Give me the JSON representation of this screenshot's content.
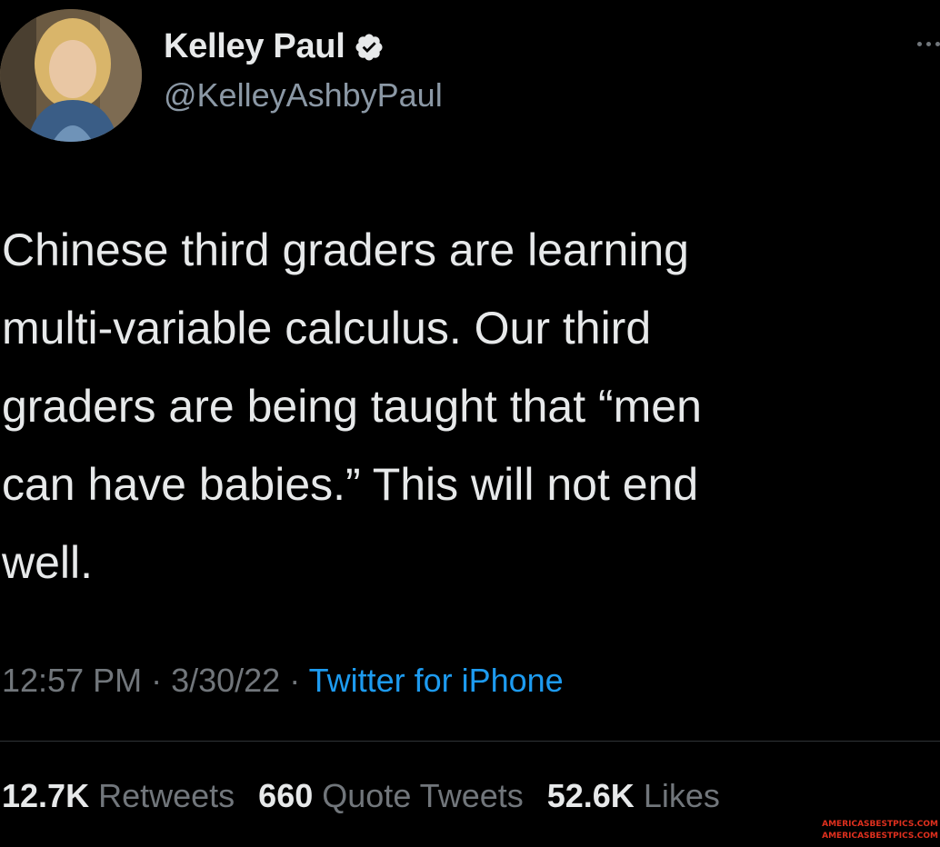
{
  "author": {
    "display_name": "Kelley Paul",
    "handle": "@KelleyAshbyPaul",
    "verified_icon": "verified-badge-icon",
    "avatar": "profile-photo"
  },
  "more_icon": "more-options-icon",
  "tweet": {
    "text": "Chinese third graders are learning\nmulti-variable calculus.  Our third\ngraders are being taught that “men\ncan have babies.”  This will not end\nwell."
  },
  "meta": {
    "time": "12:57 PM",
    "separator1": " · ",
    "date": "3/30/22",
    "separator2": " · ",
    "source": "Twitter for iPhone"
  },
  "stats": {
    "retweets_count": "12.7K",
    "retweets_label": "Retweets",
    "quotes_count": "660",
    "quotes_label": "Quote Tweets",
    "likes_count": "52.6K",
    "likes_label": "Likes"
  },
  "watermark": {
    "line1": "AMERICASBESTPICS.COM",
    "line2": "AMERICASBESTPICS.COM"
  },
  "colors": {
    "background": "#000000",
    "text": "#e7e9ea",
    "secondary": "#71767b",
    "link": "#1d9bf0",
    "verified": "#e7e9ea",
    "watermark": "#e0301e"
  }
}
